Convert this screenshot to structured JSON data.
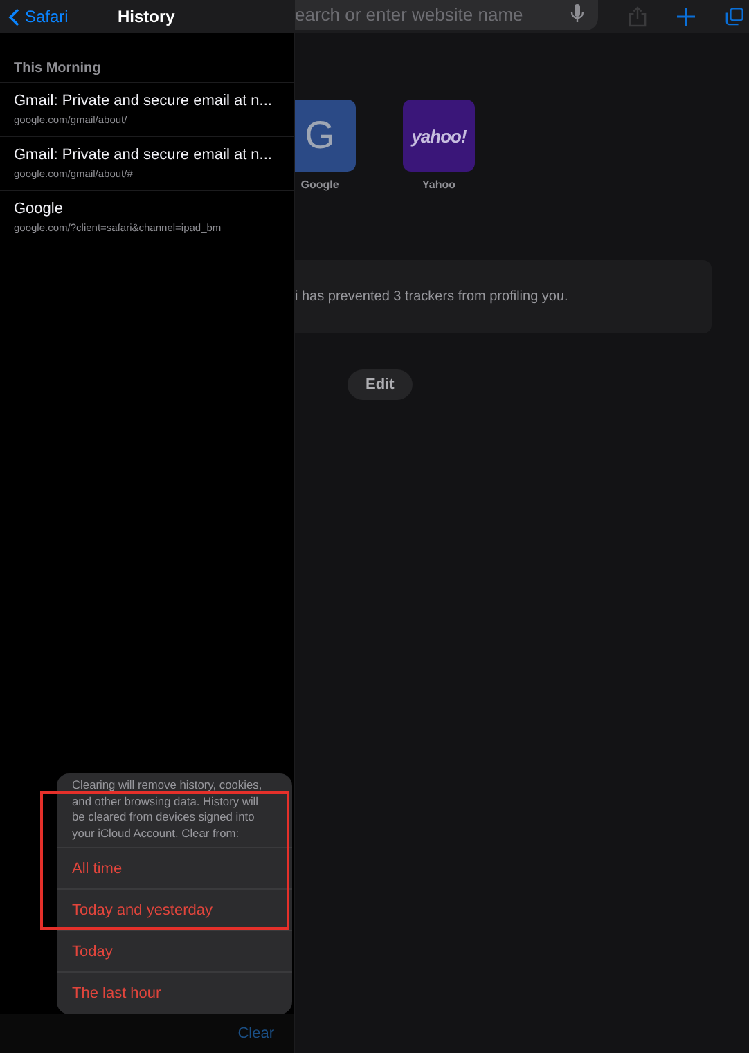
{
  "sidebar": {
    "back_label": "Safari",
    "title": "History",
    "section": "This Morning",
    "items": [
      {
        "title": "Gmail: Private and secure email at n...",
        "url": "google.com/gmail/about/"
      },
      {
        "title": "Gmail: Private and secure email at n...",
        "url": "google.com/gmail/about/#"
      },
      {
        "title": "Google",
        "url": "google.com/?client=safari&channel=ipad_bm"
      }
    ],
    "clear_label": "Clear"
  },
  "browser": {
    "search_placeholder": "earch or enter website name",
    "favorites": [
      {
        "label": "Google",
        "kind": "letter",
        "glyph": "G"
      },
      {
        "label": "Yahoo",
        "kind": "wordmark",
        "glyph": "yahoo!"
      }
    ],
    "privacy_report": "i has prevented 3 trackers from profiling you.",
    "edit_label": "Edit"
  },
  "clear_sheet": {
    "message": "Clearing will remove history, cookies, and other browsing data. History will be cleared from devices signed into your iCloud Account. Clear from:",
    "options": [
      "All time",
      "Today and yesterday",
      "Today",
      "The last hour"
    ]
  }
}
